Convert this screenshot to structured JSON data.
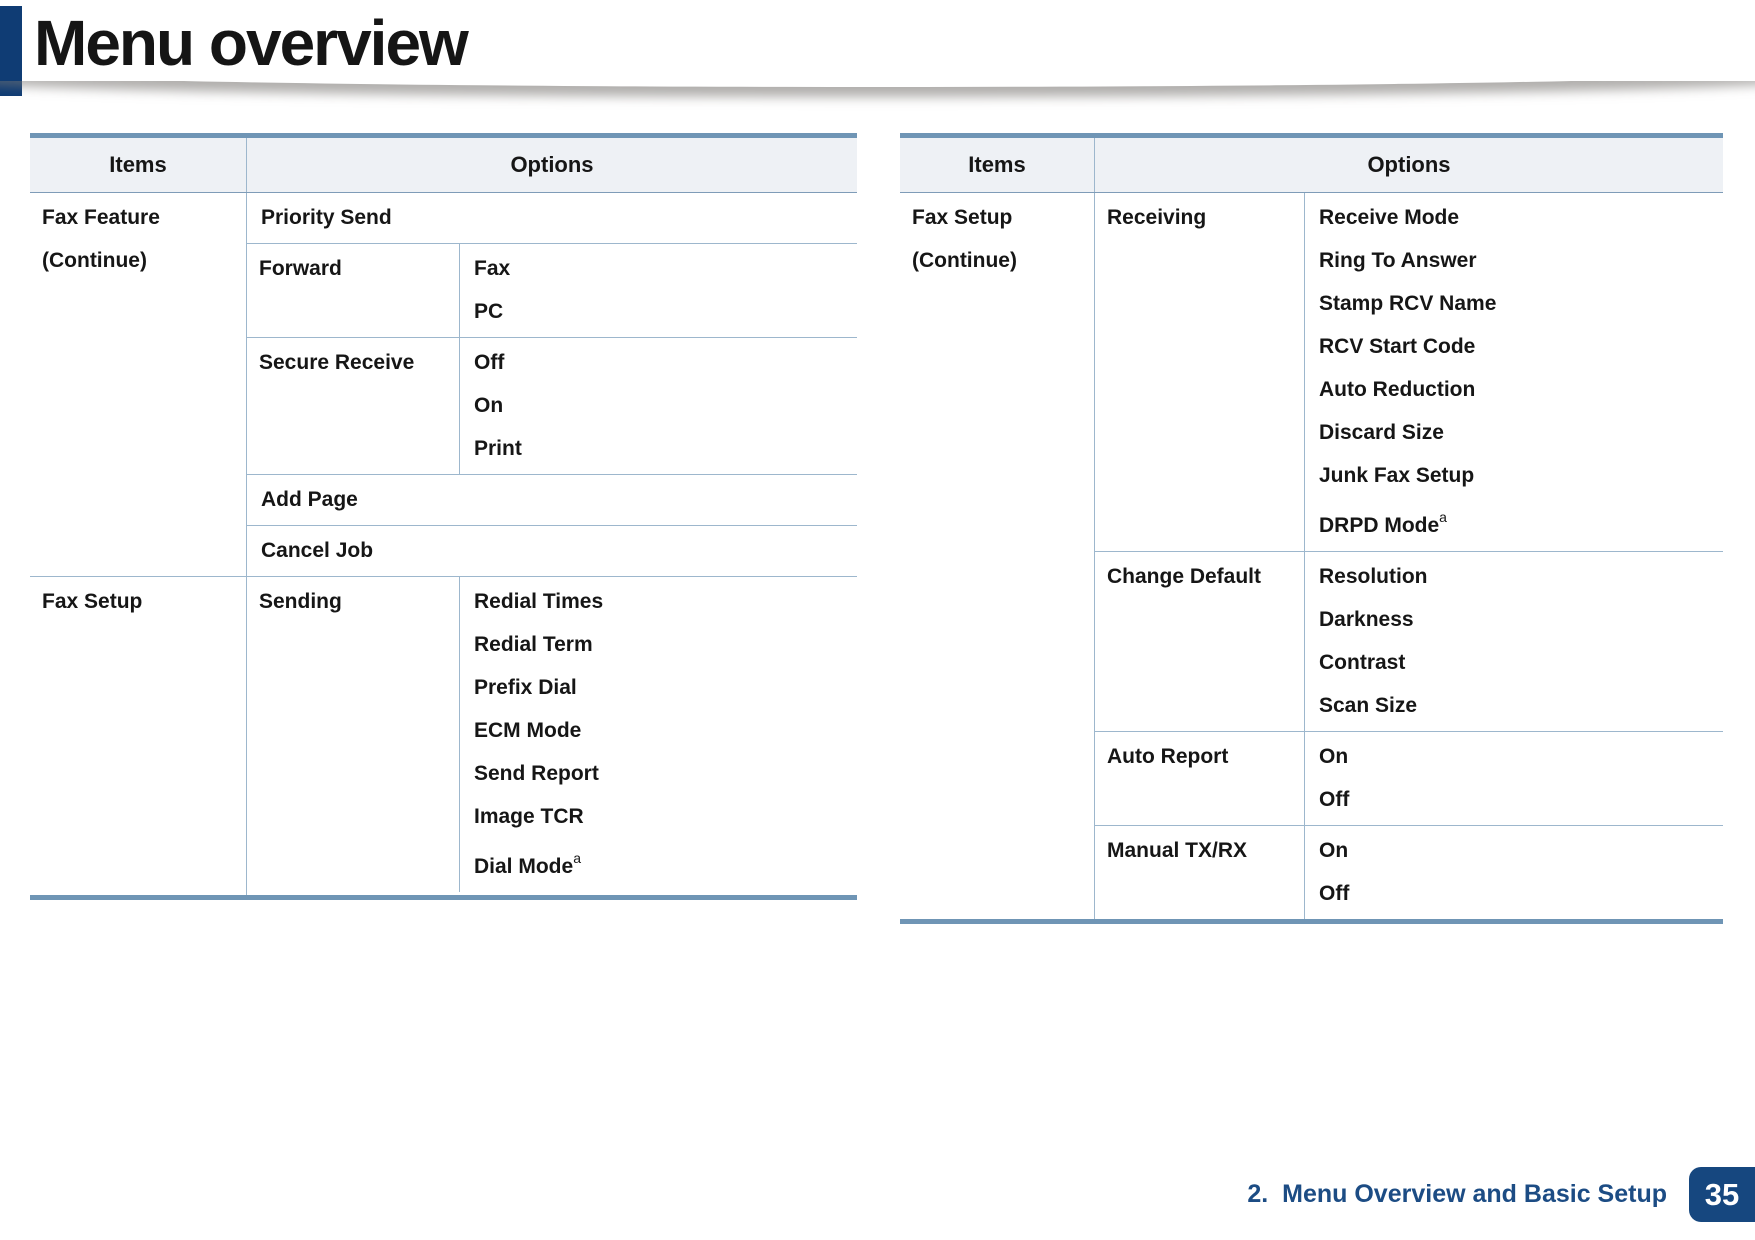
{
  "title": "Menu overview",
  "left_table": {
    "header": {
      "items": "Items",
      "options": "Options"
    },
    "fax_feature": {
      "item_line1": "Fax Feature",
      "item_line2": "(Continue)",
      "priority_send": "Priority Send",
      "forward": {
        "label": "Forward",
        "values": [
          "Fax",
          "PC"
        ]
      },
      "secure_receive": {
        "label": "Secure Receive",
        "values": [
          "Off",
          "On",
          "Print"
        ]
      },
      "add_page": "Add Page",
      "cancel_job": "Cancel Job"
    },
    "fax_setup": {
      "item": "Fax Setup",
      "sending": {
        "label": "Sending",
        "values": [
          "Redial Times",
          "Redial Term",
          "Prefix Dial",
          "ECM Mode",
          "Send Report",
          "Image TCR"
        ],
        "last_value": {
          "text": "Dial Mode",
          "sup": "a"
        }
      }
    }
  },
  "right_table": {
    "header": {
      "items": "Items",
      "options": "Options"
    },
    "fax_setup_cont": {
      "item_line1": "Fax Setup",
      "item_line2": "(Continue)",
      "receiving": {
        "label": "Receiving",
        "values": [
          "Receive Mode",
          "Ring To Answer",
          "Stamp RCV Name",
          "RCV Start Code",
          "Auto Reduction",
          "Discard Size",
          "Junk Fax Setup"
        ],
        "last_value": {
          "text": "DRPD Mode",
          "sup": "a"
        }
      },
      "change_default": {
        "label": "Change Default",
        "values": [
          "Resolution",
          "Darkness",
          "Contrast",
          "Scan Size"
        ]
      },
      "auto_report": {
        "label": "Auto Report",
        "values": [
          "On",
          "Off"
        ]
      },
      "manual_txrx": {
        "label": "Manual TX/RX",
        "values": [
          "On",
          "Off"
        ]
      }
    }
  },
  "footer": {
    "chapter": "2.  Menu Overview and Basic Setup",
    "page_number": "35"
  },
  "colors": {
    "accent": "#0f3c74",
    "table_border_thick": "#6f95b5",
    "table_border_thin": "#9db7cd",
    "header_fill": "#eef1f5",
    "footer_text": "#1c4c84",
    "badge_fill": "#16477f"
  }
}
